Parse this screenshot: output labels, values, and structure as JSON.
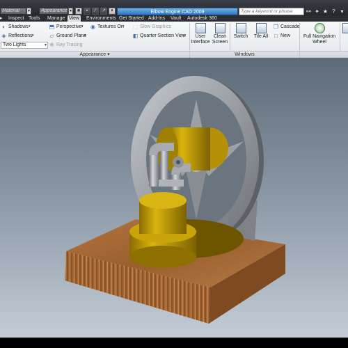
{
  "titlebar": {
    "field1": "Material",
    "field2": "Appearance",
    "app_title": "Elbow Engine CAD 2009",
    "search_placeholder": "Type a keyword or phrase",
    "icons": [
      "binoculars-icon",
      "star-icon",
      "question-icon",
      "window-controls-icon"
    ]
  },
  "tabs": [
    "Inspect",
    "Tools",
    "Manage",
    "View",
    "Environments",
    "Get Started",
    "Add-Ins",
    "Vault",
    "Autodesk 360"
  ],
  "active_tab": "View",
  "ribbon": {
    "appearance": {
      "shadows": "Shadows",
      "reflections": "Reflections",
      "lighting": "Two Lights",
      "perspective": "Perspective",
      "ground_plane": "Ground Plane",
      "ray_tracing": "Ray Tracing",
      "textures": "Textures On",
      "slow_graphics": "Slow Graphics",
      "quarter_section": "Quarter Section View",
      "label": "Appearance"
    },
    "user_interface_line1": "User",
    "user_interface_line2": "Interface",
    "clean_screen_line1": "Clean",
    "clean_screen_line2": "Screen",
    "windows": {
      "switch": "Switch",
      "tile_all": "Tile All",
      "cascade": "Cascade",
      "new": "New",
      "label": "Windows"
    },
    "navigate": {
      "full_nav_line1": "Full Navigation",
      "full_nav_line2": "Wheel"
    }
  },
  "colors": {
    "title_accent": "#2d77c0",
    "viewport_top": "#5d6a78",
    "viewport_bottom": "#c3ccd6",
    "flywheel": "#9a9ea3",
    "cylinder": "#c8a000",
    "wood_base": "#a8693a"
  }
}
